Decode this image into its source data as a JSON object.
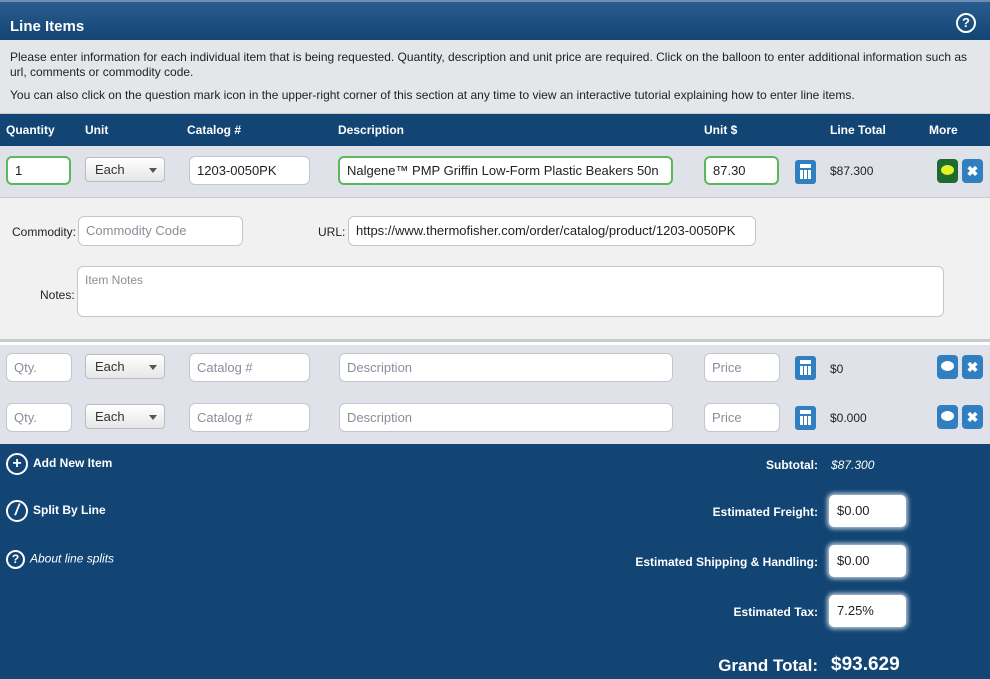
{
  "section": {
    "title": "Line Items",
    "help_icon": "question-circle-icon"
  },
  "instructions": {
    "p1": "Please enter information for each individual item that is being requested. Quantity, description and unit price are required. Click on the balloon to enter additional information such as url, comments or commodity code.",
    "p2": "You can also click on the question mark icon in the upper-right corner of this section at any time to view an interactive tutorial explaining how to enter line items."
  },
  "columns": {
    "quantity": "Quantity",
    "unit": "Unit",
    "catalog": "Catalog #",
    "description": "Description",
    "unit_price": "Unit $",
    "line_total": "Line Total",
    "more": "More"
  },
  "rows": [
    {
      "qty": "1",
      "unit": "Each",
      "catalog": "1203-0050PK",
      "description": "Nalgene™ PMP Griffin Low-Form Plastic Beakers 50n",
      "price": "87.30",
      "line_total": "$87.300"
    },
    {
      "qty_placeholder": "Qty.",
      "unit": "Each",
      "catalog_placeholder": "Catalog #",
      "description_placeholder": "Description",
      "price_placeholder": "Price",
      "line_total": "$0"
    },
    {
      "qty_placeholder": "Qty.",
      "unit": "Each",
      "catalog_placeholder": "Catalog #",
      "description_placeholder": "Description",
      "price_placeholder": "Price",
      "line_total": "$0.000"
    }
  ],
  "detail": {
    "commodity_label": "Commodity:",
    "commodity_placeholder": "Commodity Code",
    "url_label": "URL:",
    "url_value": "https://www.thermofisher.com/order/catalog/product/1203-0050PK",
    "notes_label": "Notes:",
    "notes_placeholder": "Item Notes"
  },
  "footer": {
    "add_item": "Add New Item",
    "split_by_line": "Split By Line",
    "about_splits": "About line splits",
    "subtotal_label": "Subtotal:",
    "subtotal_value": "$87.300",
    "freight_label": "Estimated Freight:",
    "freight_value": "$0.00",
    "shipping_label": "Estimated Shipping & Handling:",
    "shipping_value": "$0.00",
    "tax_label": "Estimated Tax:",
    "tax_value": "7.25%",
    "grand_total_label": "Grand Total:",
    "grand_total_value": "$93.629"
  }
}
